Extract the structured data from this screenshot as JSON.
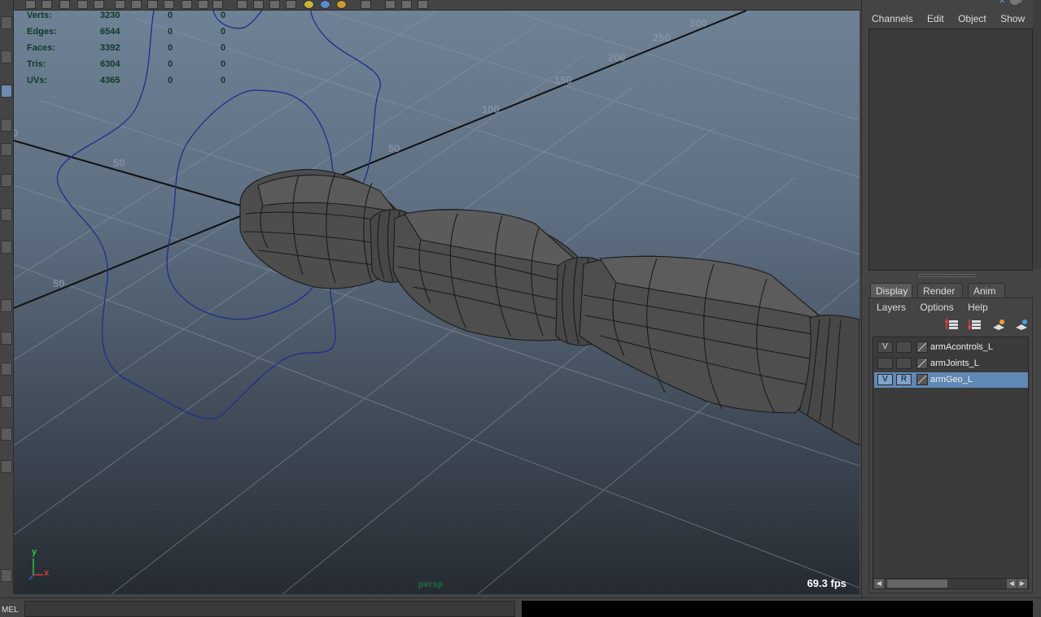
{
  "hud": {
    "rows": [
      {
        "label": "Verts:",
        "v1": "3230",
        "v2": "0",
        "v3": "0"
      },
      {
        "label": "Edges:",
        "v1": "6544",
        "v2": "0",
        "v3": "0"
      },
      {
        "label": "Faces:",
        "v1": "3392",
        "v2": "0",
        "v3": "0"
      },
      {
        "label": "Tris:",
        "v1": "6304",
        "v2": "0",
        "v3": "0"
      },
      {
        "label": "UVs:",
        "v1": "4365",
        "v2": "0",
        "v3": "0"
      }
    ]
  },
  "viewport": {
    "fps": "69.3 fps",
    "camera": "persp",
    "axis_y": "y",
    "axis_x": "x",
    "grid_labels": [
      "300",
      "250",
      "200",
      "150",
      "100",
      "50",
      "0",
      "50",
      "0",
      "50",
      "50",
      "100",
      "0"
    ]
  },
  "channel_box": {
    "menu": [
      "Channels",
      "Edit",
      "Object",
      "Show"
    ]
  },
  "layer_editor": {
    "tabs": [
      "Display",
      "Render",
      "Anim"
    ],
    "menu": [
      "Layers",
      "Options",
      "Help"
    ],
    "layers": [
      {
        "visible": "V",
        "reference": "",
        "name": "armAcontrols_L",
        "selected": false
      },
      {
        "visible": "",
        "reference": "",
        "name": "armJoints_L",
        "selected": false
      },
      {
        "visible": "V",
        "reference": "R",
        "name": "armGeo_L",
        "selected": true
      }
    ]
  },
  "command_line": {
    "mode": "MEL"
  },
  "colors": {
    "selection": "#6088b4",
    "hud_text": "#0c3b26",
    "curve": "#1c2f8c",
    "mesh": "#505050"
  }
}
